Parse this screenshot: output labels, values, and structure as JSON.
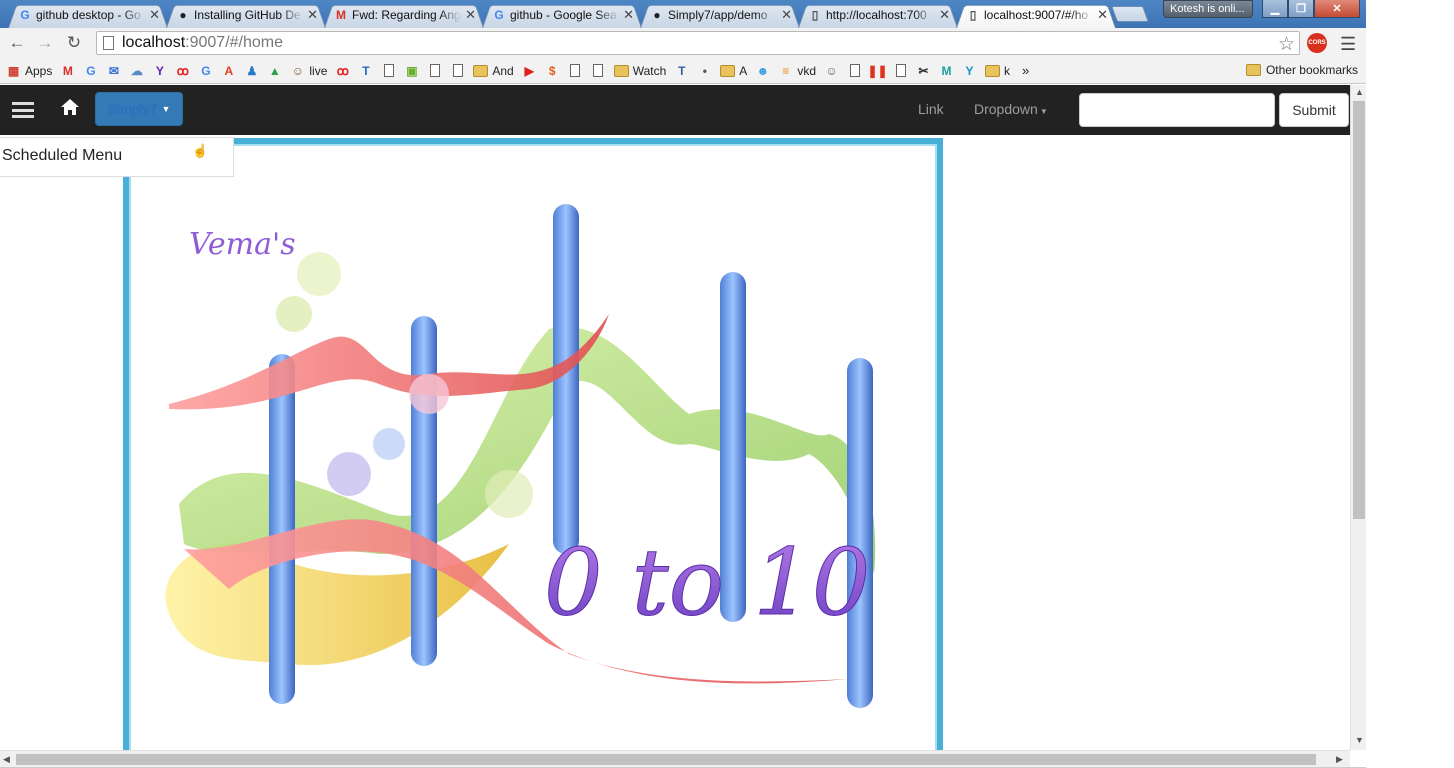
{
  "browser": {
    "tabs": [
      {
        "title": "github desktop - Go",
        "favicon": "google-icon",
        "active": false
      },
      {
        "title": "Installing GitHub De",
        "favicon": "github-icon",
        "active": false
      },
      {
        "title": "Fwd: Regarding Ang",
        "favicon": "gmail-icon",
        "active": false
      },
      {
        "title": "github - Google Sea",
        "favicon": "google-icon",
        "active": false
      },
      {
        "title": "Simply7/app/demo",
        "favicon": "github-icon",
        "active": false
      },
      {
        "title": "http://localhost:700",
        "favicon": "page-icon",
        "active": false
      },
      {
        "title": "localhost:9007/#/ho",
        "favicon": "page-icon",
        "active": true
      }
    ],
    "profile": "Kotesh is onli...",
    "url": {
      "host": "localhost",
      "path": ":9007/#/home"
    },
    "extension": "CORS",
    "bookmarks": [
      {
        "label": "Apps",
        "icon": "apps-icon"
      },
      {
        "label": "",
        "icon": "gmail-icon"
      },
      {
        "label": "",
        "icon": "google-icon"
      },
      {
        "label": "",
        "icon": "mail-icon"
      },
      {
        "label": "",
        "icon": "cloud-icon"
      },
      {
        "label": "",
        "icon": "yahoo-icon"
      },
      {
        "label": "",
        "icon": "airtel-icon"
      },
      {
        "label": "",
        "icon": "google-icon"
      },
      {
        "label": "",
        "icon": "act-icon"
      },
      {
        "label": "",
        "icon": "person-icon"
      },
      {
        "label": "",
        "icon": "drive-icon"
      },
      {
        "label": "live",
        "icon": "avatar-icon"
      },
      {
        "label": "",
        "icon": "airtel-icon"
      },
      {
        "label": "",
        "icon": "tz-icon"
      },
      {
        "label": "",
        "icon": "page-icon"
      },
      {
        "label": "",
        "icon": "video-icon"
      },
      {
        "label": "",
        "icon": "page-icon"
      },
      {
        "label": "",
        "icon": "page-icon"
      },
      {
        "label": "And",
        "icon": "folder-icon"
      },
      {
        "label": "",
        "icon": "youtube-icon"
      },
      {
        "label": "",
        "icon": "dollar-icon"
      },
      {
        "label": "",
        "icon": "page-icon"
      },
      {
        "label": "",
        "icon": "page-icon"
      },
      {
        "label": "Watch",
        "icon": "folder-icon"
      },
      {
        "label": "",
        "icon": "tn-icon"
      },
      {
        "label": "",
        "icon": "github-icon"
      },
      {
        "label": "A",
        "icon": "folder-icon"
      },
      {
        "label": "",
        "icon": "smile-icon"
      },
      {
        "label": "vkd",
        "icon": "stack-icon"
      },
      {
        "label": "",
        "icon": "avatar-icon"
      },
      {
        "label": "",
        "icon": "page-icon"
      },
      {
        "label": "",
        "icon": "pause-icon"
      },
      {
        "label": "",
        "icon": "page-icon"
      },
      {
        "label": "",
        "icon": "tools-icon"
      },
      {
        "label": "",
        "icon": "m-icon"
      },
      {
        "label": "",
        "icon": "y-icon"
      },
      {
        "label": "k",
        "icon": "folder-icon"
      }
    ],
    "bookmarks_overflow": "»",
    "other_bookmarks": "Other bookmarks"
  },
  "app": {
    "brand": "Simply7",
    "nav_link": "Link",
    "nav_dropdown": "Dropdown",
    "search_placeholder": "",
    "submit": "Submit",
    "scheduled_menu": "Scheduled Menu",
    "artwork": {
      "signature": "Vema's",
      "caption": "0 to 10"
    }
  },
  "colors": {
    "navbar": "#222222",
    "brand_button": "#337ab7",
    "frame_border": "#48b0d8"
  }
}
